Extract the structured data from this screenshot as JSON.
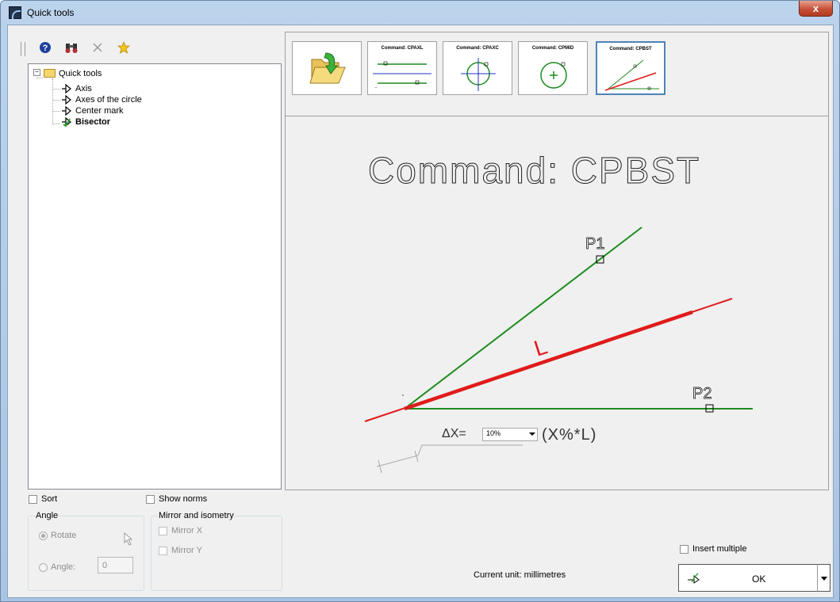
{
  "window": {
    "title": "Quick tools",
    "close_label": "x"
  },
  "toolbar": {
    "icons": [
      "help-icon",
      "binoculars-icon",
      "delete-icon",
      "favorite-star-icon"
    ]
  },
  "tree": {
    "root": "Quick tools",
    "items": [
      {
        "label": "Axis",
        "bold": false
      },
      {
        "label": "Axes of the circle",
        "bold": false
      },
      {
        "label": "Center mark",
        "bold": false
      },
      {
        "label": "Bisector",
        "bold": true
      }
    ]
  },
  "options": {
    "sort_label": "Sort",
    "show_norms_label": "Show norms",
    "angle_group": {
      "title": "Angle",
      "rotate_label": "Rotate",
      "angle_label": "Angle:",
      "angle_value": "0"
    },
    "mirror_group": {
      "title": "Mirror and isometry",
      "mirror_x_label": "Mirror X",
      "mirror_y_label": "Mirror Y"
    }
  },
  "tiles": [
    {
      "caption": "",
      "kind": "open-folder"
    },
    {
      "caption": "Command: CPAXL",
      "kind": "axis"
    },
    {
      "caption": "Command: CPAXC",
      "kind": "circle-axes"
    },
    {
      "caption": "Command: CPMID",
      "kind": "center-mark"
    },
    {
      "caption": "Command: CPBST",
      "kind": "bisector",
      "selected": true
    }
  ],
  "preview": {
    "command_text": "Command: CPBST",
    "p1_label": "P1",
    "p2_label": "P2",
    "l_label": "L",
    "delta_label": "ΔX=",
    "formula_label": "(X%*L)",
    "delta_value": "10%",
    "colors": {
      "construction": "#1d8c1d",
      "result": "#e01b1b",
      "aux": "#a8a8a8"
    }
  },
  "footer": {
    "current_unit": "Current unit: millimetres",
    "insert_multiple_label": "Insert multiple",
    "ok_label": "OK"
  }
}
